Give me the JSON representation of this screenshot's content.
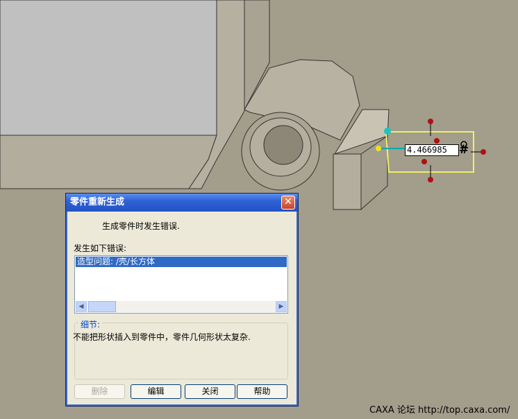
{
  "colors": {
    "background": "#a39d8b",
    "title_bar": "#2f62d6",
    "selection": "#316ac5"
  },
  "dimension": {
    "value": "4.466985",
    "lock_symbol": "#"
  },
  "dialog": {
    "title": "零件重新生成",
    "message": "生成零件时发生错误.",
    "error_label": "发生如下错误:",
    "errors": [
      "造型问题: /壳/长方体"
    ],
    "details_label": "细节:",
    "details_text": "不能把形状插入到零件中，零件几何形状太复杂.",
    "buttons": {
      "delete": "删除",
      "edit": "编辑",
      "close": "关闭",
      "help": "帮助"
    }
  },
  "watermark": "CAXA 论坛 http://top.caxa.com/"
}
